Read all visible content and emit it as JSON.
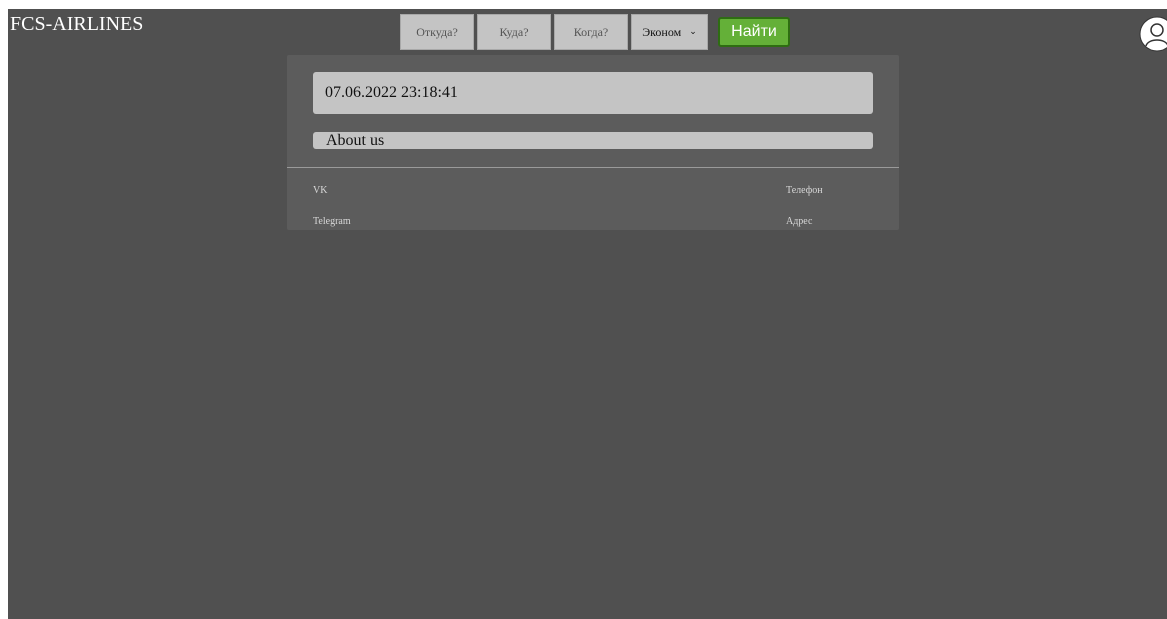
{
  "header": {
    "logo": "FCS-AIRLINES",
    "search": {
      "from_placeholder": "Откуда?",
      "to_placeholder": "Куда?",
      "when_placeholder": "Когда?",
      "class_selected": "Эконом",
      "find_label": "Найти"
    },
    "avatar_icon": "user-icon"
  },
  "main": {
    "datetime": "07.06.2022 23:18:41",
    "about_label": "About us"
  },
  "footer": {
    "vk": "VK",
    "telegram": "Telegram",
    "phone": "Телефон",
    "address": "Адрес"
  },
  "colors": {
    "background": "#505050",
    "panel": "#5c5c5c",
    "field": "#c4c4c4",
    "accent_green": "#64b038"
  }
}
